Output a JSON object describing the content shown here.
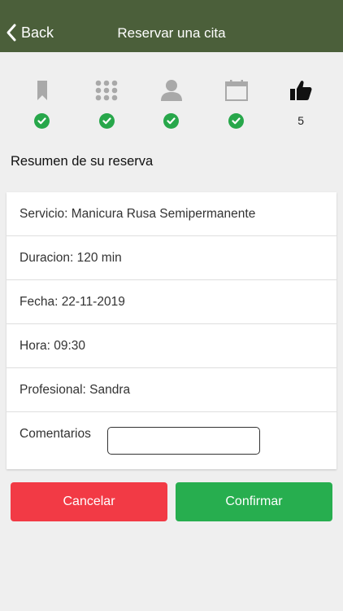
{
  "header": {
    "back_label": "Back",
    "title": "Reservar una cita"
  },
  "steps": [
    {
      "icon": "bookmark-icon",
      "status": "done"
    },
    {
      "icon": "grid-icon",
      "status": "done"
    },
    {
      "icon": "person-icon",
      "status": "done"
    },
    {
      "icon": "calendar-icon",
      "status": "done"
    },
    {
      "icon": "thumbs-up-icon",
      "status": "current",
      "number": "5"
    }
  ],
  "summary": {
    "title": "Resumen de su reserva",
    "servicio": "Servicio: Manicura Rusa Semipermanente",
    "duracion": "Duracion: 120 min",
    "fecha": "Fecha: 22-11-2019",
    "hora": "Hora: 09:30",
    "profesional": "Profesional: Sandra",
    "comentarios_label": "Comentarios",
    "comentarios_value": ""
  },
  "actions": {
    "cancel_label": "Cancelar",
    "confirm_label": "Confirmar"
  },
  "colors": {
    "navbar": "#4b5f3a",
    "check": "#27a74a",
    "cancel": "#f23a45",
    "confirm": "#27ae4f",
    "inactive_icon": "#a9a9a9"
  }
}
